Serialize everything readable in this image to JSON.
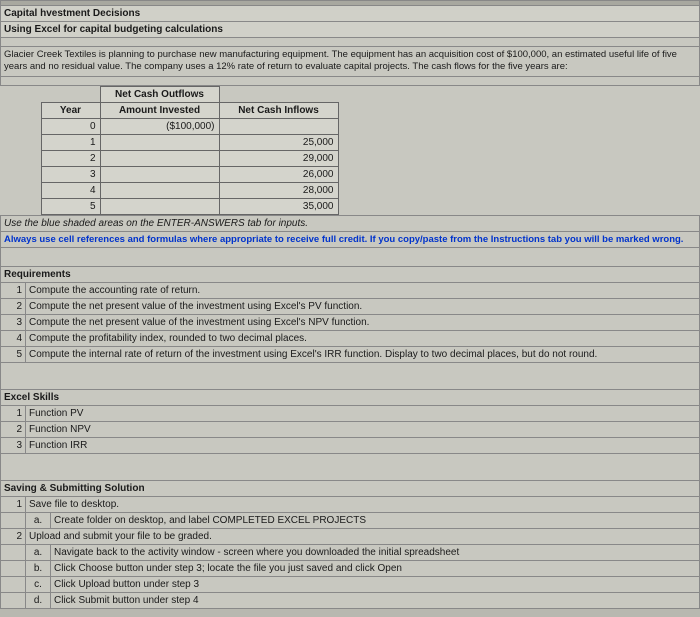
{
  "title1": "Capital hvestment Decisions",
  "title2": "Using Excel for capital budgeting calculations",
  "description": "Glacier Creek Textiles is planning to purchase new manufacturing equipment. The equipment has an acquisition cost of $100,000, an estimated useful life of five years and no residual value. The company uses a 12% rate of return to evaluate capital projects. The cash flows for the five years are:",
  "cash_table": {
    "h_outflows": "Net Cash Outflows",
    "h_year": "Year",
    "h_amount": "Amount Invested",
    "h_inflows": "Net Cash Inflows",
    "rows": [
      {
        "year": "0",
        "outflow": "($100,000)",
        "inflow": ""
      },
      {
        "year": "1",
        "outflow": "",
        "inflow": "25,000"
      },
      {
        "year": "2",
        "outflow": "",
        "inflow": "29,000"
      },
      {
        "year": "3",
        "outflow": "",
        "inflow": "26,000"
      },
      {
        "year": "4",
        "outflow": "",
        "inflow": "28,000"
      },
      {
        "year": "5",
        "outflow": "",
        "inflow": "35,000"
      }
    ]
  },
  "note1": "Use the blue shaded areas on the ENTER-ANSWERS tab for inputs.",
  "note2": "Always use cell references and formulas where appropriate to receive full credit. If you copy/paste from the Instructions tab you will be marked wrong.",
  "req_header": "Requirements",
  "req": [
    "Compute the accounting rate of return.",
    "Compute the net present value of the investment using Excel's PV function.",
    "Compute the net present value of the investment using Excel's NPV function.",
    "Compute the profitability index, rounded to two decimal places.",
    "Compute the internal rate of return of the investment using Excel's IRR function. Display to two decimal places, but do not round."
  ],
  "skills_header": "Excel Skills",
  "skills": [
    "Function PV",
    "Function NPV",
    "Function IRR"
  ],
  "saving_header": "Saving & Submitting Solution",
  "saving": [
    {
      "n": "1",
      "t": "Save file to desktop."
    },
    {
      "n": "a.",
      "t": "Create folder on desktop, and label COMPLETED EXCEL PROJECTS",
      "sub": true
    },
    {
      "n": "2",
      "t": "Upload and submit your file to be graded."
    },
    {
      "n": "a.",
      "t": "Navigate back to the activity window - screen where you downloaded the initial spreadsheet",
      "sub": true
    },
    {
      "n": "b.",
      "t": "Click Choose button under step 3; locate the file you just saved and click Open",
      "sub": true
    },
    {
      "n": "c.",
      "t": "Click Upload button under step 3",
      "sub": true
    },
    {
      "n": "d.",
      "t": "Click Submit button under step 4",
      "sub": true
    }
  ]
}
